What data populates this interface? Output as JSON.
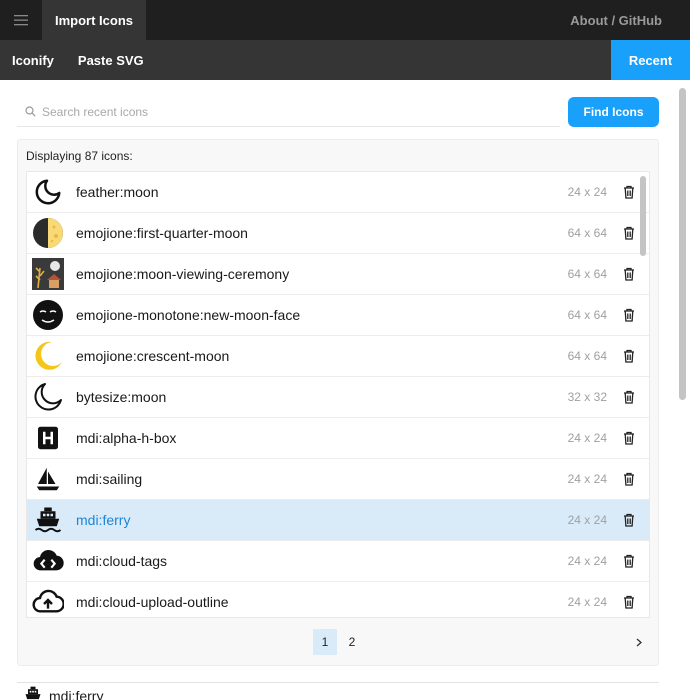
{
  "topbar": {
    "menu_icon": "hamburger-menu-icon",
    "active_tab": "Import Icons",
    "about_link": "About / GitHub"
  },
  "subbar": {
    "tabs": [
      "Iconify",
      "Paste SVG"
    ],
    "recent_tab": "Recent"
  },
  "search": {
    "placeholder": "Search recent icons",
    "value": "",
    "button_label": "Find Icons"
  },
  "results": {
    "count_text": "Displaying 87 icons:",
    "items": [
      {
        "name": "feather:moon",
        "size": "24 x 24",
        "icon": "moon-outline-icon"
      },
      {
        "name": "emojione:first-quarter-moon",
        "size": "64 x 64",
        "icon": "first-quarter-moon-icon"
      },
      {
        "name": "emojione:moon-viewing-ceremony",
        "size": "64 x 64",
        "icon": "moon-viewing-ceremony-icon"
      },
      {
        "name": "emojione-monotone:new-moon-face",
        "size": "64 x 64",
        "icon": "new-moon-face-icon"
      },
      {
        "name": "emojione:crescent-moon",
        "size": "64 x 64",
        "icon": "crescent-moon-icon"
      },
      {
        "name": "bytesize:moon",
        "size": "32 x 32",
        "icon": "moon-outline-icon"
      },
      {
        "name": "mdi:alpha-h-box",
        "size": "24 x 24",
        "icon": "alpha-h-box-icon"
      },
      {
        "name": "mdi:sailing",
        "size": "24 x 24",
        "icon": "sailboat-icon"
      },
      {
        "name": "mdi:ferry",
        "size": "24 x 24",
        "icon": "ferry-icon",
        "selected": true
      },
      {
        "name": "mdi:cloud-tags",
        "size": "24 x 24",
        "icon": "cloud-tags-icon"
      },
      {
        "name": "mdi:cloud-upload-outline",
        "size": "24 x 24",
        "icon": "cloud-upload-outline-icon"
      }
    ],
    "delete_icon": "trash-icon"
  },
  "pagination": {
    "pages": [
      "1",
      "2"
    ],
    "current": "1",
    "next_icon": "chevron-right-icon"
  },
  "selected_icon": {
    "name": "mdi:ferry",
    "icon": "ferry-icon"
  },
  "colors": {
    "accent": "#18a0fb",
    "selected_row": "#d9ebf9",
    "selected_text": "#1c86d6",
    "topbar": "#1f1f1f",
    "subbar": "#353535"
  }
}
